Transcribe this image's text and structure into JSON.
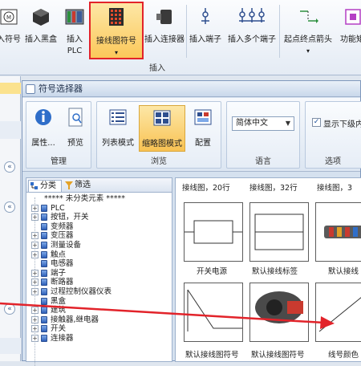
{
  "main_ribbon": {
    "buttons": [
      {
        "label": "入符号"
      },
      {
        "label": "插入黑盒"
      },
      {
        "label": "插入",
        "label2": "PLC"
      },
      {
        "label": "接线图符号"
      },
      {
        "label": "插入连接器"
      },
      {
        "label": "插入端子"
      },
      {
        "label": "插入多个端子"
      },
      {
        "label": "起点终点箭头"
      },
      {
        "label": "功能矩"
      }
    ],
    "group_label": "插入"
  },
  "dialog": {
    "title": "符号选择器",
    "groups": [
      {
        "label": "管理",
        "buttons": [
          {
            "label": "属性..."
          },
          {
            "label": "预览"
          }
        ]
      },
      {
        "label": "浏览",
        "buttons": [
          {
            "label": "列表模式"
          },
          {
            "label": "缩略图模式"
          },
          {
            "label": "配置"
          }
        ]
      },
      {
        "label": "语言",
        "select_value": "简体中文"
      },
      {
        "label": "选项",
        "checkbox_label": "显示下级内容",
        "checked": true
      }
    ],
    "tree_tabs": [
      {
        "label": "分类"
      },
      {
        "label": "筛选"
      }
    ],
    "tree_items": [
      {
        "label": "***** 未分类元素 *****",
        "has_expander": false,
        "has_icon": false
      },
      {
        "label": "PLC",
        "has_expander": true,
        "has_icon": true
      },
      {
        "label": "按钮，开关",
        "has_expander": true,
        "has_icon": true
      },
      {
        "label": "变频器",
        "has_expander": false,
        "has_icon": true
      },
      {
        "label": "变压器",
        "has_expander": true,
        "has_icon": true
      },
      {
        "label": "测量设备",
        "has_expander": true,
        "has_icon": true
      },
      {
        "label": "触点",
        "has_expander": true,
        "has_icon": true
      },
      {
        "label": "电感器",
        "has_expander": false,
        "has_icon": true
      },
      {
        "label": "端子",
        "has_expander": true,
        "has_icon": true
      },
      {
        "label": "断路器",
        "has_expander": true,
        "has_icon": true
      },
      {
        "label": "过程控制仪器仪表",
        "has_expander": true,
        "has_icon": true
      },
      {
        "label": "黑盒",
        "has_expander": false,
        "has_icon": true
      },
      {
        "label": "建筑",
        "has_expander": true,
        "has_icon": true
      },
      {
        "label": "接触器,继电器",
        "has_expander": true,
        "has_icon": true
      },
      {
        "label": "开关",
        "has_expander": true,
        "has_icon": true
      },
      {
        "label": "连接器",
        "has_expander": true,
        "has_icon": true
      }
    ],
    "grid": {
      "top_captions": [
        "接线图，20行",
        "接线图，32行",
        "接线图，3"
      ],
      "tiles": [
        {
          "caption": "开关电源"
        },
        {
          "caption": "默认接线标签"
        },
        {
          "caption": "默认接线"
        },
        {
          "caption": "默认接线图符号"
        },
        {
          "caption": "默认接线图符号"
        },
        {
          "caption": "线号颜色"
        }
      ]
    }
  },
  "colors": {
    "highlight_border": "#e2232a",
    "arrow": "#e2232a",
    "active_btn": "#fbc85a"
  }
}
